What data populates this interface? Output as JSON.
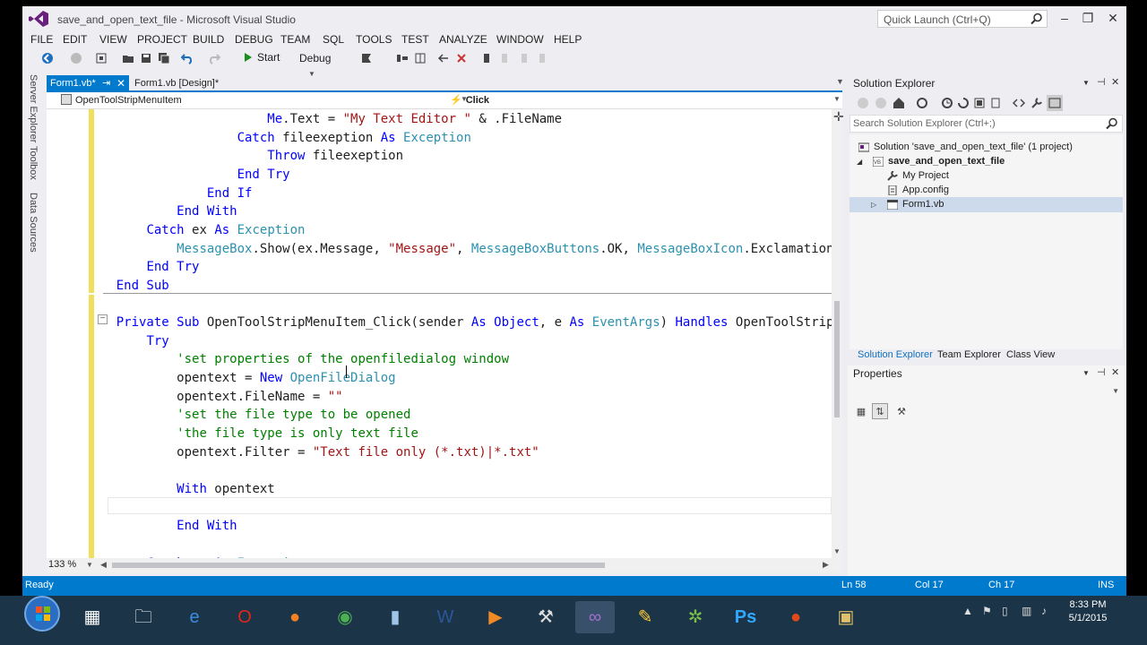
{
  "window": {
    "title": "save_and_open_text_file - Microsoft Visual Studio",
    "quick_launch_placeholder": "Quick Launch (Ctrl+Q)",
    "controls": {
      "minimize": "–",
      "restore": "❐",
      "close": "✕"
    }
  },
  "menu": [
    "FILE",
    "EDIT",
    "VIEW",
    "PROJECT",
    "BUILD",
    "DEBUG",
    "TEAM",
    "SQL",
    "TOOLS",
    "TEST",
    "ANALYZE",
    "WINDOW",
    "HELP"
  ],
  "toolbar": {
    "start_label": "Start",
    "configuration": "Debug"
  },
  "left_dock": [
    "Server Explorer",
    "Toolbox",
    "Data Sources"
  ],
  "doc_tabs": {
    "active": "Form1.vb*",
    "active_pin": "⇥",
    "active_close": "✕",
    "inactive": "Form1.vb [Design]*"
  },
  "nav_bar": {
    "left": "OpenToolStripMenuItem",
    "right": "Click"
  },
  "editor": {
    "lines": [
      [
        {
          "t": "                        ",
          "c": ""
        },
        {
          "t": "Me",
          "c": "kw"
        },
        {
          "t": ".Text = ",
          "c": ""
        },
        {
          "t": "\"My Text Editor \"",
          "c": "st"
        },
        {
          "t": " & .FileName",
          "c": ""
        }
      ],
      [
        {
          "t": "                    ",
          "c": ""
        },
        {
          "t": "Catch",
          "c": "kw"
        },
        {
          "t": " fileexeption ",
          "c": ""
        },
        {
          "t": "As",
          "c": "kw"
        },
        {
          "t": " ",
          "c": ""
        },
        {
          "t": "Exception",
          "c": "ty"
        }
      ],
      [
        {
          "t": "                        ",
          "c": ""
        },
        {
          "t": "Throw",
          "c": "kw"
        },
        {
          "t": " fileexeption",
          "c": ""
        }
      ],
      [
        {
          "t": "                    ",
          "c": ""
        },
        {
          "t": "End Try",
          "c": "kw"
        }
      ],
      [
        {
          "t": "                ",
          "c": ""
        },
        {
          "t": "End If",
          "c": "kw"
        }
      ],
      [
        {
          "t": "            ",
          "c": ""
        },
        {
          "t": "End With",
          "c": "kw"
        }
      ],
      [
        {
          "t": "        ",
          "c": ""
        },
        {
          "t": "Catch",
          "c": "kw"
        },
        {
          "t": " ex ",
          "c": ""
        },
        {
          "t": "As",
          "c": "kw"
        },
        {
          "t": " ",
          "c": ""
        },
        {
          "t": "Exception",
          "c": "ty"
        }
      ],
      [
        {
          "t": "            ",
          "c": ""
        },
        {
          "t": "MessageBox",
          "c": "ty"
        },
        {
          "t": ".Show(ex.Message, ",
          "c": ""
        },
        {
          "t": "\"Message\"",
          "c": "st"
        },
        {
          "t": ", ",
          "c": ""
        },
        {
          "t": "MessageBoxButtons",
          "c": "ty"
        },
        {
          "t": ".OK, ",
          "c": ""
        },
        {
          "t": "MessageBoxIcon",
          "c": "ty"
        },
        {
          "t": ".Exclamation)",
          "c": ""
        }
      ],
      [
        {
          "t": "        ",
          "c": ""
        },
        {
          "t": "End Try",
          "c": "kw"
        }
      ],
      [
        {
          "t": "    ",
          "c": ""
        },
        {
          "t": "End Sub",
          "c": "kw"
        }
      ],
      [],
      [
        {
          "t": "    ",
          "c": ""
        },
        {
          "t": "Private Sub",
          "c": "kw"
        },
        {
          "t": " OpenToolStripMenuItem_Click(sender ",
          "c": ""
        },
        {
          "t": "As",
          "c": "kw"
        },
        {
          "t": " ",
          "c": ""
        },
        {
          "t": "Object",
          "c": "kw"
        },
        {
          "t": ", e ",
          "c": ""
        },
        {
          "t": "As",
          "c": "kw"
        },
        {
          "t": " ",
          "c": ""
        },
        {
          "t": "EventArgs",
          "c": "ty"
        },
        {
          "t": ") ",
          "c": ""
        },
        {
          "t": "Handles",
          "c": "kw"
        },
        {
          "t": " OpenToolStripMenuItem.Click",
          "c": ""
        }
      ],
      [
        {
          "t": "        ",
          "c": ""
        },
        {
          "t": "Try",
          "c": "kw"
        }
      ],
      [
        {
          "t": "            ",
          "c": ""
        },
        {
          "t": "'set properties of the openfiledialog window",
          "c": "cm"
        }
      ],
      [
        {
          "t": "            opentext = ",
          "c": ""
        },
        {
          "t": "New",
          "c": "kw"
        },
        {
          "t": " ",
          "c": ""
        },
        {
          "t": "OpenFileDialog",
          "c": "ty"
        }
      ],
      [
        {
          "t": "            opentext.FileName = ",
          "c": ""
        },
        {
          "t": "\"\"",
          "c": "st"
        }
      ],
      [
        {
          "t": "            ",
          "c": ""
        },
        {
          "t": "'set the file type to be opened",
          "c": "cm"
        }
      ],
      [
        {
          "t": "            ",
          "c": ""
        },
        {
          "t": "'the file type is only text file",
          "c": "cm"
        }
      ],
      [
        {
          "t": "            opentext.Filter = ",
          "c": ""
        },
        {
          "t": "\"Text file only (*.txt)|*.txt\"",
          "c": "st"
        }
      ],
      [],
      [
        {
          "t": "            ",
          "c": ""
        },
        {
          "t": "With",
          "c": "kw"
        },
        {
          "t": " opentext",
          "c": ""
        }
      ],
      [],
      [
        {
          "t": "            ",
          "c": ""
        },
        {
          "t": "End With",
          "c": "kw"
        }
      ],
      [],
      [
        {
          "t": "        ",
          "c": ""
        },
        {
          "t": "Catch",
          "c": "kw"
        },
        {
          "t": " ex ",
          "c": ""
        },
        {
          "t": "As",
          "c": "kw"
        },
        {
          "t": " ",
          "c": ""
        },
        {
          "t": "Exception",
          "c": "ty"
        }
      ]
    ],
    "collapse_glyph": "−"
  },
  "editor_footer": {
    "zoom": "133 %"
  },
  "solution_explorer": {
    "title": "Solution Explorer",
    "search_placeholder": "Search Solution Explorer (Ctrl+;)",
    "tree": [
      {
        "label": "Solution 'save_and_open_text_file' (1 project)",
        "level": 0,
        "bold": false
      },
      {
        "label": "save_and_open_text_file",
        "level": 1,
        "bold": true
      },
      {
        "label": "My Project",
        "level": 2,
        "bold": false
      },
      {
        "label": "App.config",
        "level": 2,
        "bold": false
      },
      {
        "label": "Form1.vb",
        "level": 2,
        "bold": false
      }
    ],
    "tabs": [
      "Solution Explorer",
      "Team Explorer",
      "Class View"
    ]
  },
  "properties": {
    "title": "Properties"
  },
  "status_bar": {
    "state": "Ready",
    "line": "Ln 58",
    "col": "Col 17",
    "ch": "Ch 17",
    "mode": "INS"
  },
  "taskbar": {
    "time": "8:33 PM",
    "date": "5/1/2015"
  },
  "colors": {
    "accent": "#007acc",
    "keyword": "#0000ff",
    "type": "#2b91af",
    "string": "#a31515",
    "comment": "#008000"
  }
}
